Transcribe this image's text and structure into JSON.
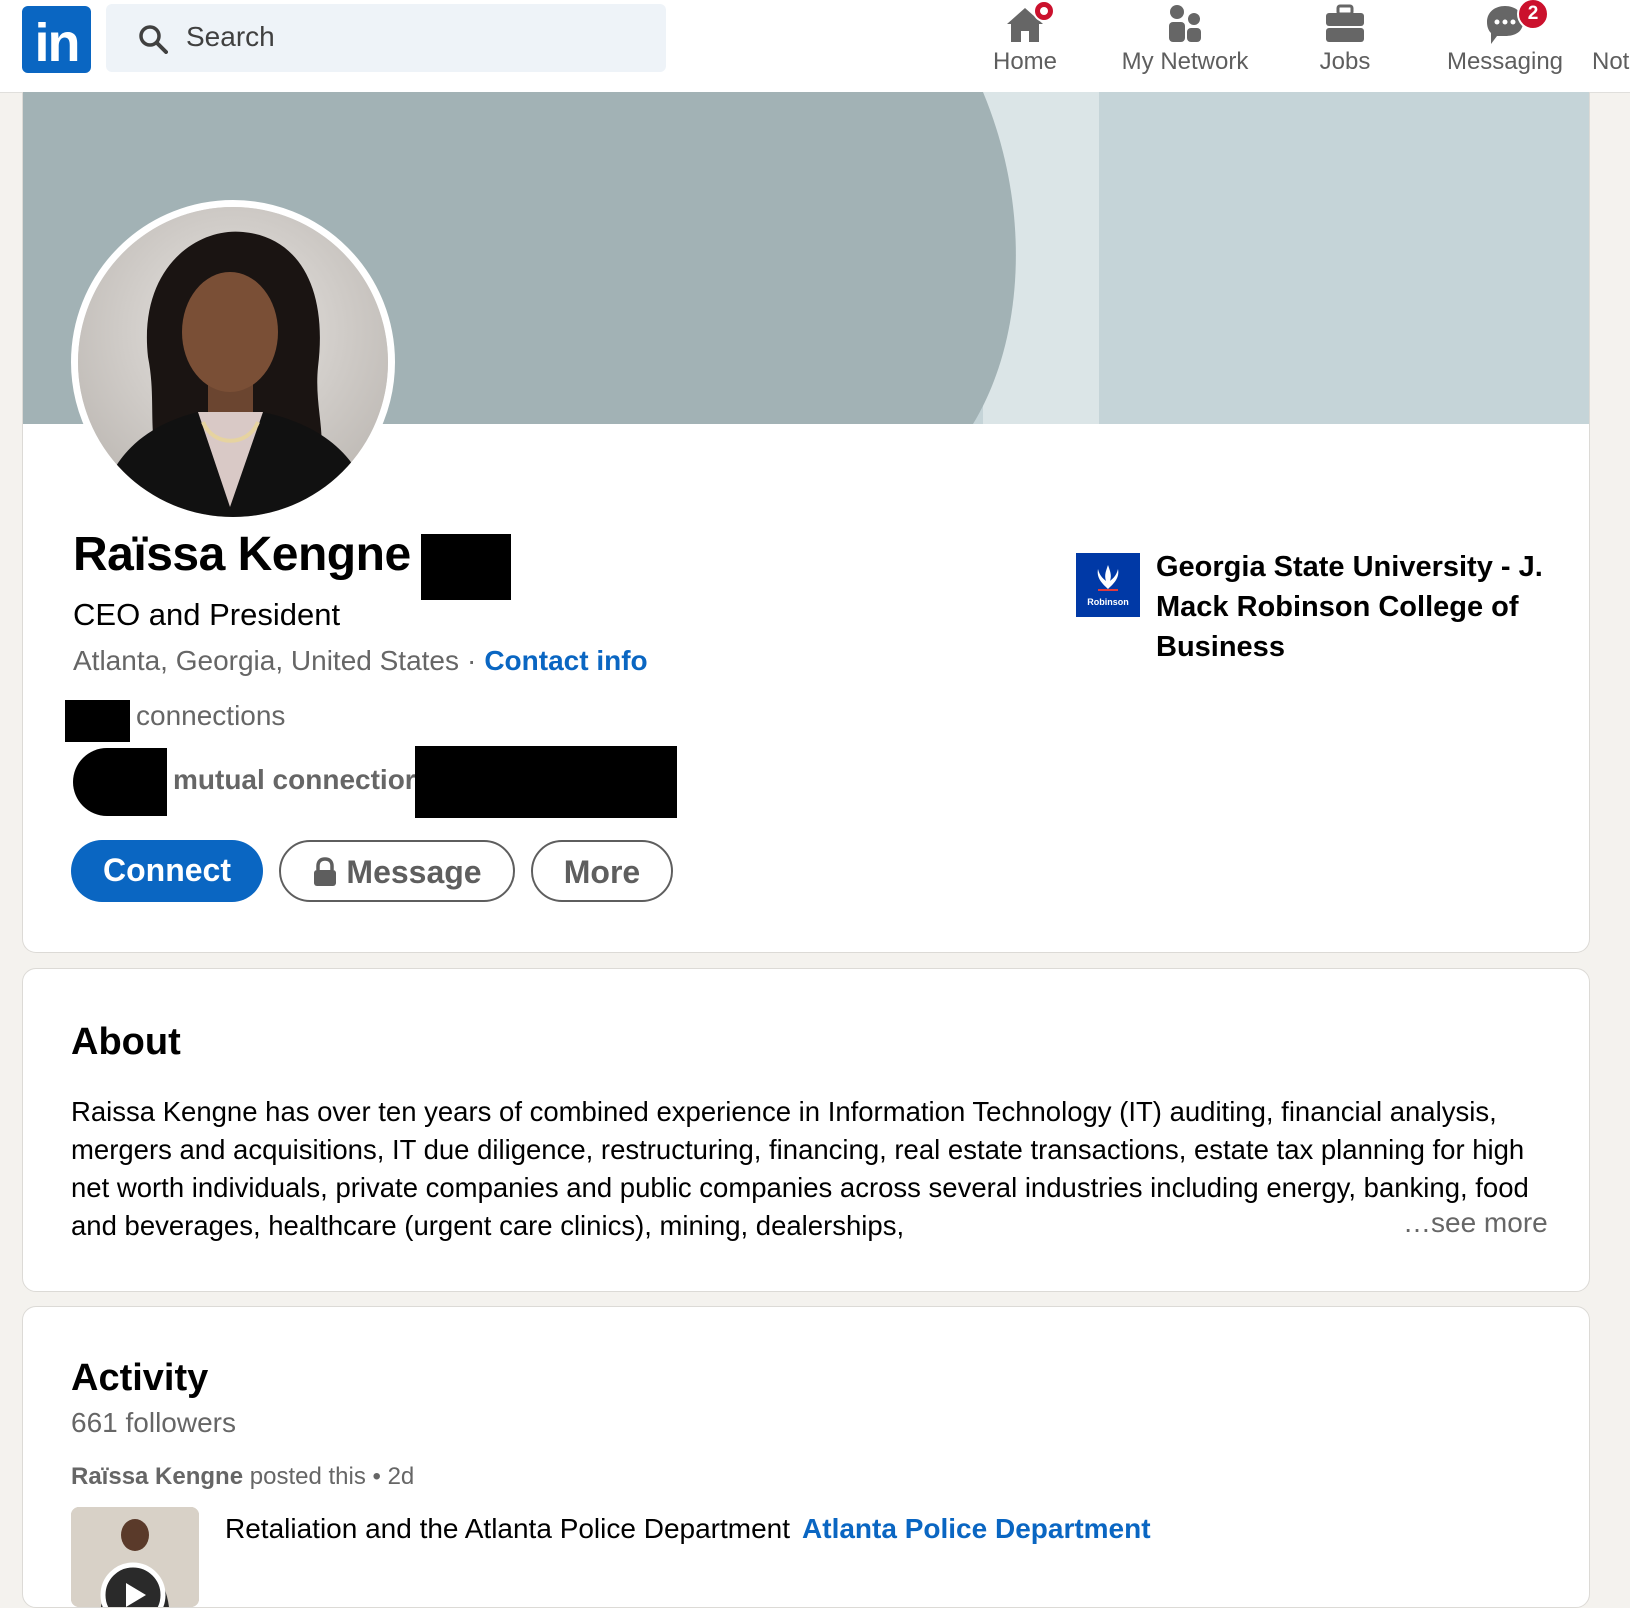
{
  "nav": {
    "logo_text": "in",
    "search_placeholder": "Search",
    "items": [
      {
        "label": "Home",
        "icon": "home-icon",
        "badge": ""
      },
      {
        "label": "My Network",
        "icon": "network-icon",
        "badge": ""
      },
      {
        "label": "Jobs",
        "icon": "briefcase-icon",
        "badge": ""
      },
      {
        "label": "Messaging",
        "icon": "messaging-icon",
        "badge": "2"
      },
      {
        "label": "Not",
        "icon": "bell-icon",
        "badge": ""
      }
    ]
  },
  "profile": {
    "name": "Raïssa Kengne",
    "headline": "CEO and President",
    "location": "Atlanta, Georgia, United States",
    "separator": "·",
    "contact_info": "Contact info",
    "connections_label": "connections",
    "mutual_label": "mutual connectior",
    "buttons": {
      "connect": "Connect",
      "message": "Message",
      "more": "More"
    },
    "education": {
      "logo_text": "Robinson",
      "name": "Georgia State University - J. Mack Robinson College of Business"
    }
  },
  "about": {
    "title": "About",
    "text": "Raissa Kengne has over ten years of combined experience in Information Technology (IT) auditing, financial analysis, mergers and acquisitions, IT due diligence, restructuring, financing, real estate transactions, estate tax planning for high net worth individuals, private companies and public companies across several industries including energy, banking, food and beverages, healthcare (urgent care clinics), mining, dealerships,",
    "see_more": "…see more"
  },
  "activity": {
    "title": "Activity",
    "followers": "661 followers",
    "post_author": "Raïssa Kengne",
    "post_action": "posted this",
    "post_time": "2d",
    "post_title": "Retaliation and the Atlanta Police Department",
    "post_tag": "Atlanta Police Department"
  },
  "colors": {
    "brand": "#0a66c2",
    "badge": "#cb112d",
    "page_bg": "#f4f2ee"
  }
}
